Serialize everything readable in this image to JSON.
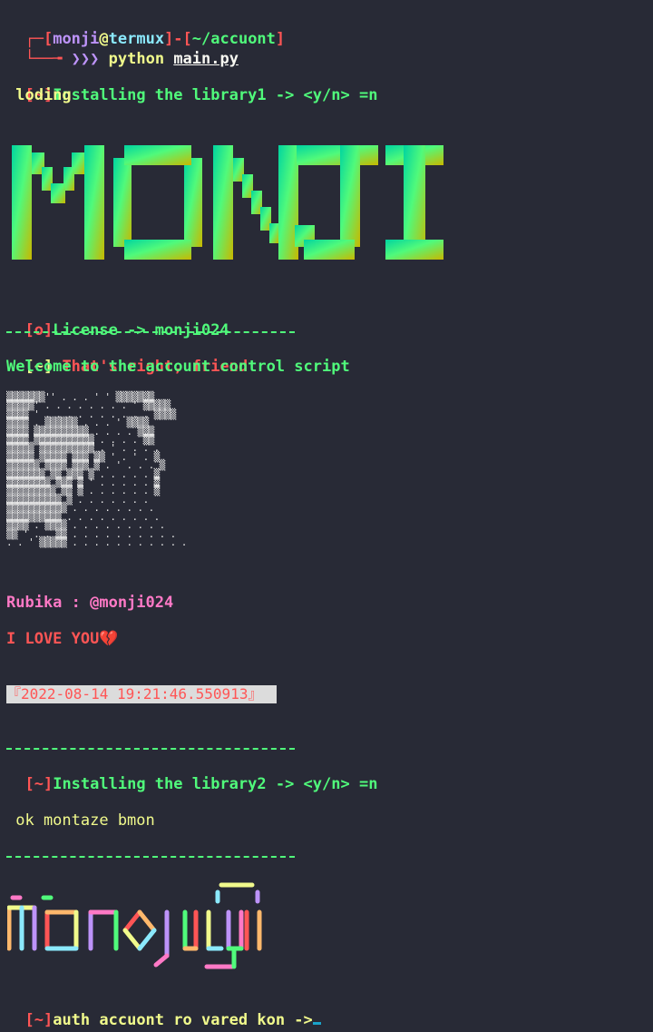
{
  "prompt": {
    "box_open": "┌─[",
    "user": "monji",
    "at": "@",
    "host": "termux",
    "sep": "]-[",
    "path": "~/accuont",
    "close": "]",
    "line2_prefix": "└──╼ ",
    "arrows": "❯❯❯",
    "command": "python",
    "file": "main.py"
  },
  "install1": {
    "tag": "[~]",
    "text": "Installing the library1 -> <y/n> =n"
  },
  "loading": " loding",
  "banner": {
    "text": "MONJI",
    "gradient_start": "#00d4a0",
    "gradient_mid": "#50fa7b",
    "gradient_end": "#c8b800"
  },
  "license": {
    "tag": "[o]",
    "text": "License -> monji024"
  },
  "divider_text": "---------------------------------",
  "greeting": {
    "tag": "[~]",
    "text": " That's right, friend"
  },
  "welcome": "Welcome to the account control script",
  "portrait_lines": [
    "▒▒▒▒▒▒▒'' . . . ' ' ▒▒▒▒▒▒▒",
    "▒▒▒▒▒' . . . . . . . . ' ▒▒▒▒▒",
    "▒▒▒▒ ' . . . . . . . . . . ▒▒▒▒",
    "▒▒▒▒ . ▒▒▒▒▒▒ . . . ' ▒▒▒▒",
    "▒▒▒▒ ▒▒▒▒▒▒▒▒▒▒ . . . . ▒▒▒",
    "▒▒▒▒ ▒▒▒▒▒▒▒▒▒▒▒ . . . . ▒▒",
    "▒▒▒▒▒ ▒▒▒▒▒▒▒▒▒▒ . ' . . . .",
    "▒▒▒▒▒ ▒▒▒▒▒ ▒▒▒ ▒▒ ' . ' . ▒",
    "▒▒▒▒▒▒ ▒▒▒▒ ▒▒▒ ▒ . ' . . . ▒",
    "▒▒▒▒▒▒▒ ▒▒ ▒▒▒ ▒ . . . . . ▒",
    "▒▒▒▒▒▒▒▒ ▒▒▒ ▒ ' . . . . . ▒",
    "▒▒▒▒▒▒▒▒▒ ▒▒ ▒ . . . . . . ▒",
    "▒▒▒▒▒▒▒▒▒▒ ▒ . . . . . . .",
    "▒▒▒▒▒▒▒▒▒▒▒ . . . . . . . .",
    "▒▒▒▒▒▒▒▒▒▒ . . . . . . . . .",
    "▒▒▒▒ . ▒▒▒▒ . . . . . . . . .",
    "▒▒ ' . . ▒▒ . . . . . . . . . .",
    ". . ' ▒▒▒▒▒ . . . . . . . . . . ."
  ],
  "rubika": "Rubika : @monji024",
  "love": "I LOVE YOU💔",
  "timestamp": "『2022-08-14 19:21:46.550913』",
  "install2": {
    "tag": "[~]",
    "text": "Installing the library2 -> <y/n> =n"
  },
  "ok_message": " ok montaze bmon",
  "auth": {
    "tag": "[~]",
    "text": "auth accuont ro vared kon ->"
  },
  "logo": {
    "text": "monji",
    "colors": [
      "#ffb86c",
      "#f1fa8c",
      "#8be9fd",
      "#bd93f9",
      "#ff79c6",
      "#50fa7b",
      "#ff5555"
    ]
  }
}
